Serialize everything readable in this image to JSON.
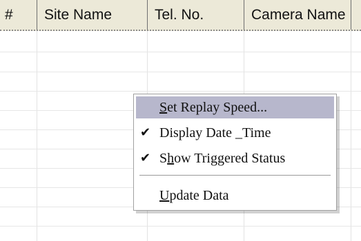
{
  "table": {
    "columns": [
      "#",
      "Site Name",
      "Tel. No.",
      "Camera Name"
    ]
  },
  "context_menu": {
    "items": [
      {
        "pre": "",
        "mnemonic": "S",
        "post": "et Replay Speed...",
        "checked": false,
        "highlighted": true
      },
      {
        "pre": "Display Date ",
        "mnemonic": "_",
        "post": "Time",
        "checked": true,
        "highlighted": false
      },
      {
        "pre": "S",
        "mnemonic": "h",
        "post": "ow Triggered Status",
        "checked": true,
        "highlighted": false
      },
      {
        "pre": "",
        "mnemonic": "U",
        "post": "pdate Data",
        "checked": false,
        "highlighted": false
      }
    ],
    "check_glyph": "✔"
  }
}
